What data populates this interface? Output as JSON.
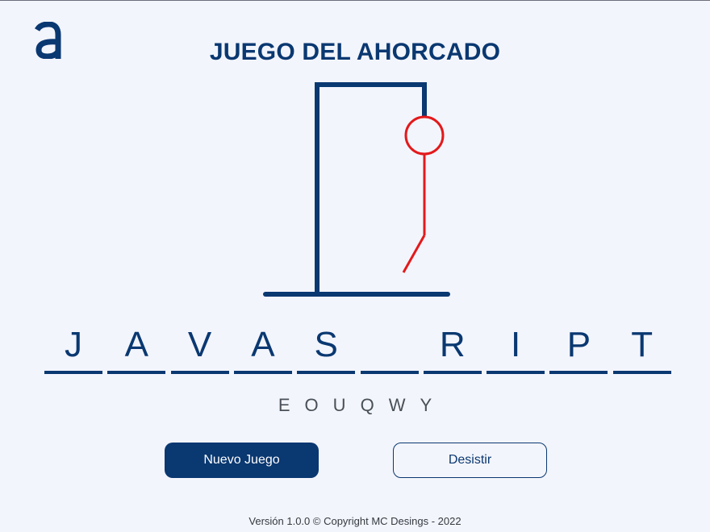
{
  "header": {
    "logo": "a",
    "title": "JUEGO DEL AHORCADO"
  },
  "colors": {
    "primary": "#0a3871",
    "hangman": "#e3191b",
    "background": "#f3f5fc"
  },
  "game": {
    "word_slots": [
      "J",
      "A",
      "V",
      "A",
      "S",
      "",
      "R",
      "I",
      "P",
      "T"
    ],
    "wrong_letters": [
      "E",
      "O",
      "U",
      "Q",
      "W",
      "Y"
    ]
  },
  "buttons": {
    "new_game": "Nuevo Juego",
    "give_up": "Desistir"
  },
  "footer": {
    "text": "Versión 1.0.0 © Copyright MC Desings - 2022"
  }
}
